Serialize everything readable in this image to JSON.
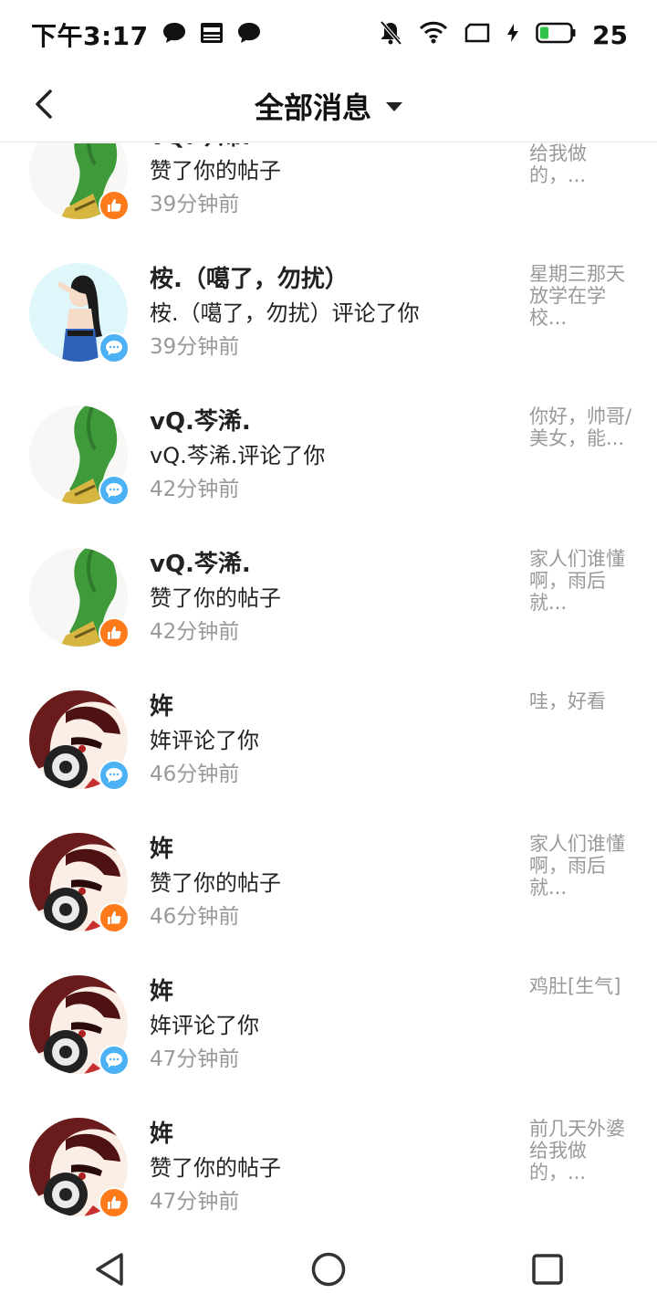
{
  "status": {
    "time": "下午3:17",
    "battery": "25",
    "left_icons": [
      "chat-bubble-icon",
      "news-icon",
      "chat-bubble-icon"
    ],
    "right_icons": [
      "bell-muted-icon",
      "wifi-icon",
      "screen-icon",
      "charging-icon",
      "battery-icon"
    ]
  },
  "header": {
    "title": "全部消息",
    "back_icon": "back-arrow-icon",
    "dropdown_icon": "caret-down-icon"
  },
  "messages": [
    {
      "name": "vQ.芩浠.",
      "action": "赞了你的帖子",
      "time": "39分钟前",
      "preview": "前几天外婆给我做的，...",
      "type": "like",
      "avatar": "green-hair-avatar"
    },
    {
      "name": "桉.（噶了，勿扰）",
      "action": "桉.（噶了，勿扰）评论了你",
      "time": "39分钟前",
      "preview": "星期三那天放学在学校...",
      "type": "comment",
      "avatar": "saluting-girl-avatar"
    },
    {
      "name": "vQ.芩浠.",
      "action": "vQ.芩浠.评论了你",
      "time": "42分钟前",
      "preview": "你好，帅哥/美女，能...",
      "type": "comment",
      "avatar": "green-hair-avatar"
    },
    {
      "name": "vQ.芩浠.",
      "action": "赞了你的帖子",
      "time": "42分钟前",
      "preview": "家人们谁懂啊，雨后就...",
      "type": "like",
      "avatar": "green-hair-avatar"
    },
    {
      "name": "姩",
      "action": "姩评论了你",
      "time": "46分钟前",
      "preview": "哇，好看",
      "type": "comment",
      "avatar": "headphone-girl-avatar"
    },
    {
      "name": "姩",
      "action": "赞了你的帖子",
      "time": "46分钟前",
      "preview": "家人们谁懂啊，雨后就...",
      "type": "like",
      "avatar": "headphone-girl-avatar"
    },
    {
      "name": "姩",
      "action": "姩评论了你",
      "time": "47分钟前",
      "preview": "鸡肚[生气]",
      "type": "comment",
      "avatar": "headphone-girl-avatar"
    },
    {
      "name": "姩",
      "action": "赞了你的帖子",
      "time": "47分钟前",
      "preview": "前几天外婆给我做的，...",
      "type": "like",
      "avatar": "headphone-girl-avatar"
    }
  ],
  "nav": {
    "back_icon": "nav-back-icon",
    "home_icon": "nav-home-icon",
    "recents_icon": "nav-recents-icon"
  },
  "colors": {
    "like_badge": "#ff7a1a",
    "comment_badge": "#4db2f5",
    "secondary_text": "#999999"
  }
}
